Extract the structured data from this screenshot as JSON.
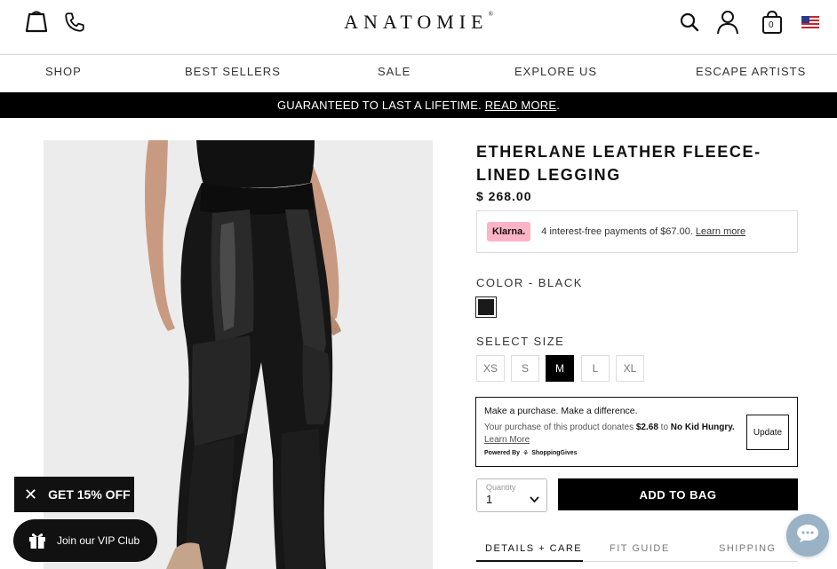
{
  "header": {
    "logo_text": "ANATOMIE",
    "cart_count": "0",
    "icons": [
      "bag-outline-icon",
      "phone-icon",
      "search-icon",
      "account-icon",
      "cart-icon",
      "us-flag-icon"
    ]
  },
  "nav": {
    "items": [
      "SHOP",
      "BEST SELLERS",
      "SALE",
      "EXPLORE US",
      "ESCAPE ARTISTS"
    ]
  },
  "banner": {
    "text": "GUARANTEED TO LAST A LIFETIME.",
    "link": "READ MORE",
    "suffix": "."
  },
  "product": {
    "title": "ETHERLANE LEATHER FLEECE-LINED LEGGING",
    "price": "$ 268.00",
    "klarna": {
      "badge": "Klarna.",
      "text": "4 interest-free payments of $67.00.",
      "link": "Learn more"
    },
    "color_label": "COLOR - BLACK",
    "color_hex": "#1a1a1a",
    "size_label": "SELECT SIZE",
    "sizes": [
      "XS",
      "S",
      "M",
      "L",
      "XL"
    ],
    "selected_size": "M",
    "donation": {
      "heading": "Make a purchase. Make a difference.",
      "text_before": "Your purchase of this product donates",
      "amount": "$2.68",
      "text_to": "to",
      "charity": "No Kid Hungry.",
      "link": "Learn More",
      "powered_by": "Powered By",
      "brand": "ShoppingGives",
      "button": "Update"
    },
    "quantity_label": "Quantity",
    "quantity_value": "1",
    "add_to_bag": "ADD TO BAG",
    "tabs": [
      "DETAILS + CARE",
      "FIT GUIDE",
      "SHIPPING"
    ]
  },
  "promo": {
    "text": "GET 15% OFF"
  },
  "vip": {
    "text": "Join our VIP Club"
  },
  "colors": {
    "accent": "#000000",
    "klarna_pink": "#ffb3c7",
    "chat_bubble": "#99b2c6"
  }
}
